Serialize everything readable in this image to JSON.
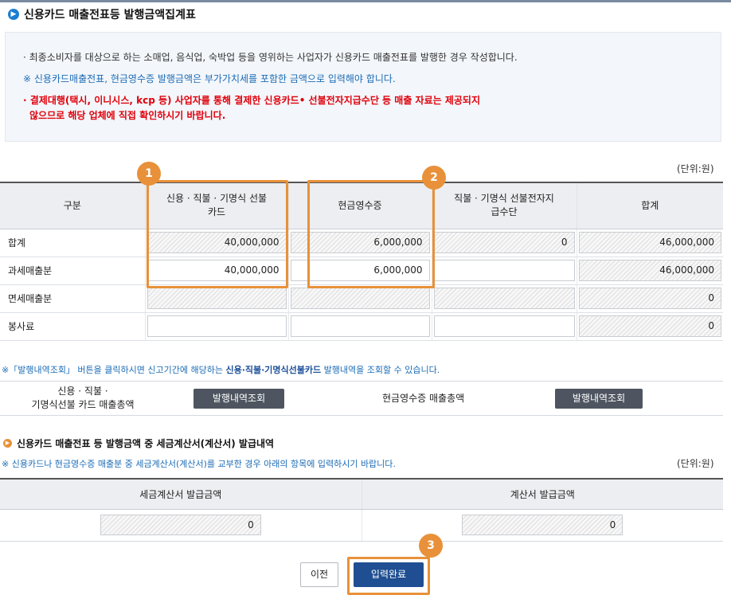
{
  "title": "신용카드 매출전표등 발행금액집계표",
  "notices": {
    "line1": "· 최종소비자를 대상으로 하는 소매업, 음식업, 숙박업 등을 영위하는 사업자가 신용카드 매출전표를 발행한 경우 작성합니다.",
    "line2": "※ 신용카드매출전표, 현금영수증 발행금액은 부가가치세를 포함한 금액으로 입력해야 합니다.",
    "line3a": "· 결제대행(택시, 이니시스, kcp 등) 사업자를 통해 결제한 신용카드• 선불전자지급수단 등 매출 자료는 제공되지",
    "line3b": "않으므로 해당 업체에 직접 확인하시기 바랍니다."
  },
  "unit_label": "(단위:원)",
  "table": {
    "headers": [
      "구분",
      "신용 · 직불 · 기명식 선불카드",
      "현금영수증",
      "직불 · 기명식 선불전자지급수단",
      "합계"
    ],
    "rows": [
      {
        "label": "합계",
        "c1": "40,000,000",
        "c2": "6,000,000",
        "c3": "0",
        "total": "46,000,000"
      },
      {
        "label": "과세매출분",
        "c1": "40,000,000",
        "c2": "6,000,000",
        "c3": "",
        "total": "46,000,000"
      },
      {
        "label": "면세매출분",
        "c1": "",
        "c2": "",
        "c3": "",
        "total": "0"
      },
      {
        "label": "봉사료",
        "c1": "",
        "c2": "",
        "c3": "",
        "total": "0"
      }
    ]
  },
  "badges": [
    "1",
    "2",
    "3"
  ],
  "hint": {
    "pre": "※「발행내역조회」 버튼을 클릭하시면 신고기간에 해당하는 ",
    "bold": "신용·직불·기명식선불카드",
    "post": " 발행내역을 조회할 수 있습니다."
  },
  "issue": {
    "card_label_1": "신용 · 직불 ·",
    "card_label_2": "기명식선불 카드 매출총액",
    "card_button": "발행내역조회",
    "cash_label": "현금영수증 매출총액",
    "cash_button": "발행내역조회"
  },
  "tax_section": {
    "title": "신용카드 매출전표 등 발행금액 중 세금계산서(계산서) 발급내역",
    "hint": "※ 신용카드나 현금영수증 매출분 중 세금계산서(계산서)를 교부한 경우 아래의 항목에 입력하시기 바랍니다.",
    "unit_label": "(단위:원)",
    "headers": [
      "세금계산서 발급금액",
      "계산서 발급금액"
    ],
    "values": [
      "0",
      "0"
    ]
  },
  "buttons": {
    "prev": "이전",
    "done": "입력완료"
  },
  "colors": {
    "accent_orange": "#e8913a",
    "primary_blue": "#1f4f92",
    "notice_red": "#e0000b",
    "hint_blue": "#1c6cb6"
  }
}
